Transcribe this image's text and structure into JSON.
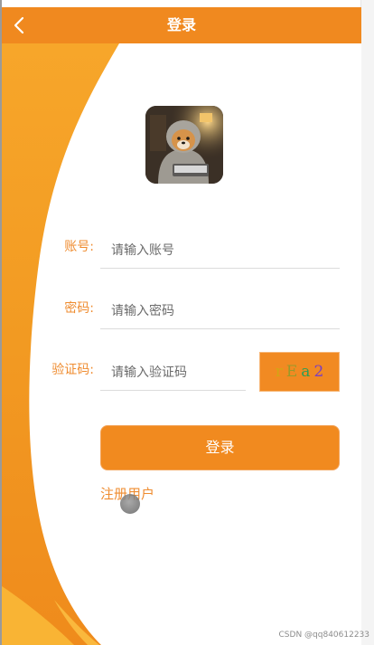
{
  "header": {
    "title": "登录",
    "back_icon": "chevron-left-icon",
    "background_color": "#f0891f"
  },
  "avatar": {
    "description_icon": "avatar-image"
  },
  "form": {
    "account": {
      "label": "账号:",
      "placeholder": "请输入账号",
      "value": ""
    },
    "password": {
      "label": "密码:",
      "placeholder": "请输入密码",
      "value": ""
    },
    "captcha_field": {
      "label": "验证码:",
      "placeholder": "请输入验证码",
      "value": ""
    },
    "captcha_chars": [
      {
        "char": "r",
        "color": "#d4a514"
      },
      {
        "char": "E",
        "color": "#9a9a2a"
      },
      {
        "char": "a",
        "color": "#2f9e54"
      },
      {
        "char": "2",
        "color": "#7a3fc2"
      }
    ],
    "login_button": "登录",
    "register_link": "注册用户"
  },
  "watermark": "CSDN @qq840612233",
  "colors": {
    "accent": "#f18a1f",
    "label": "#ef8c30",
    "wave_light": "#f9b02e",
    "wave_dark": "#f0861c"
  }
}
